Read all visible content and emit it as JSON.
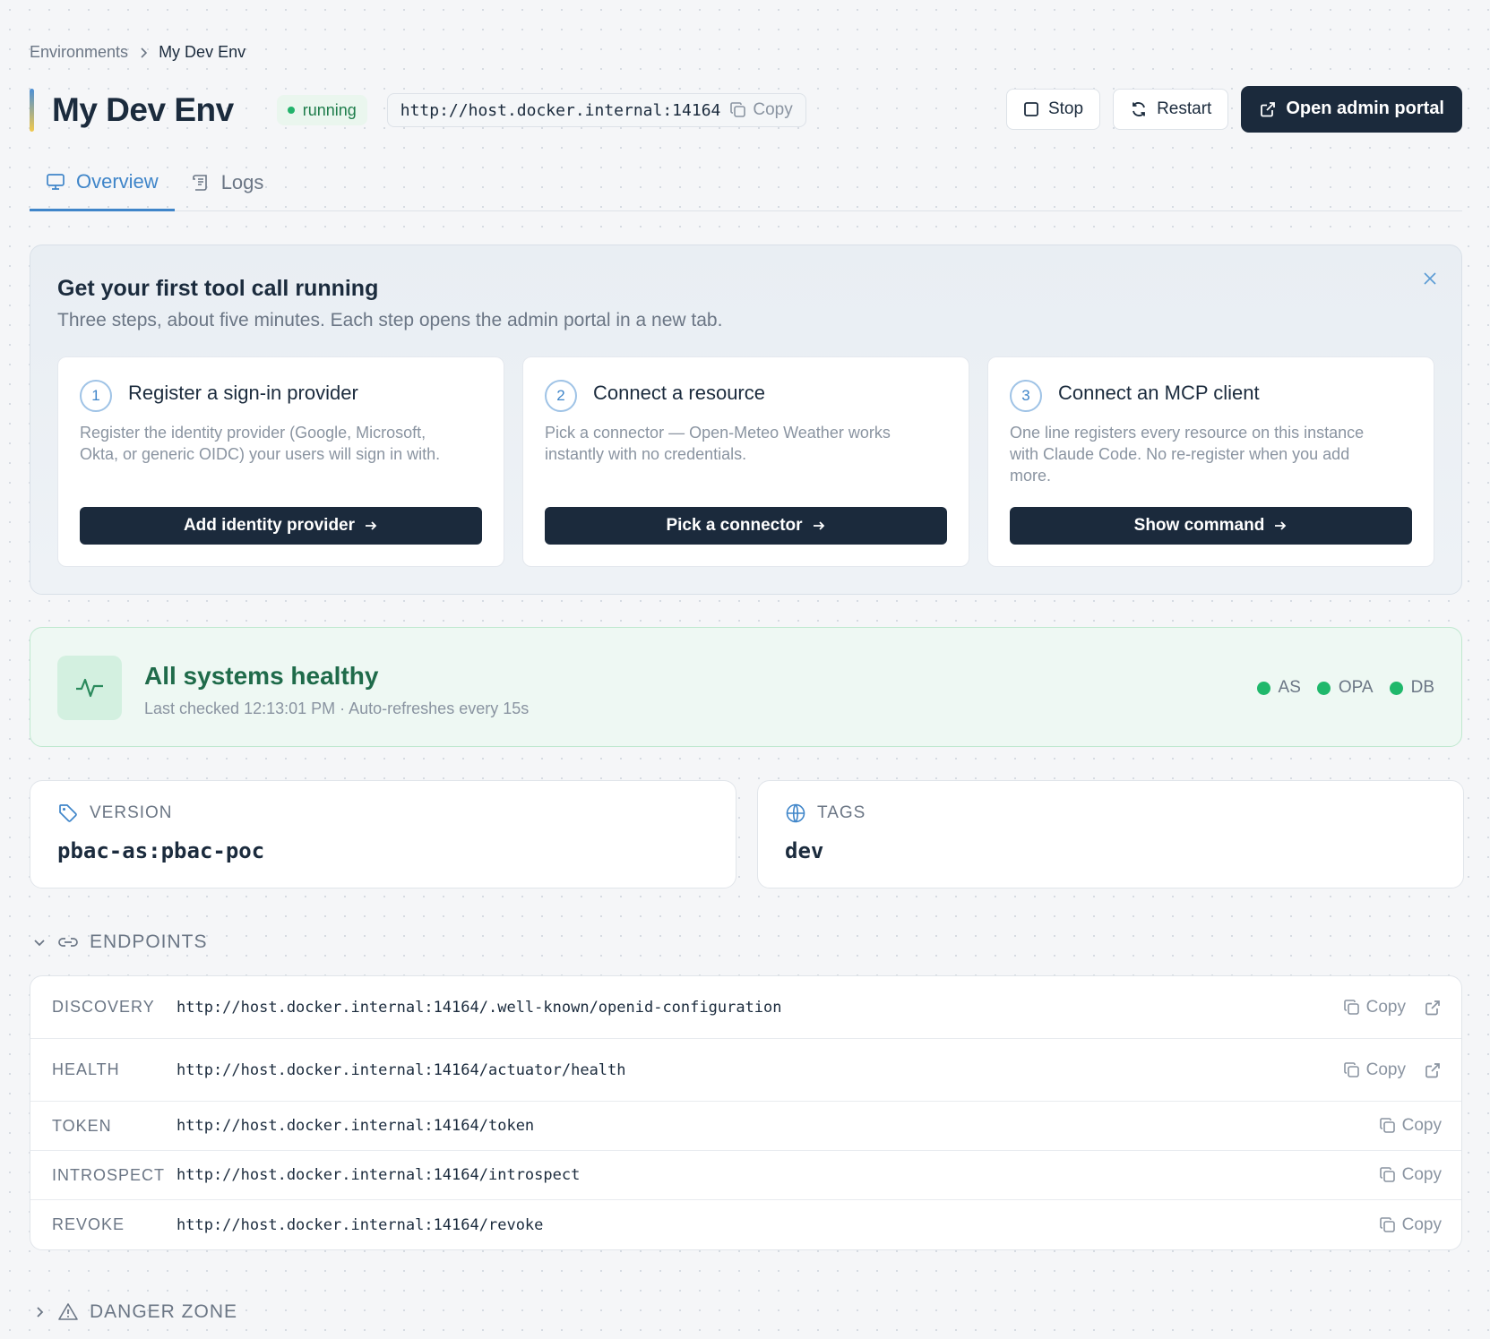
{
  "breadcrumb": {
    "parent": "Environments",
    "current": "My Dev Env"
  },
  "header": {
    "title": "My Dev Env",
    "status": "running",
    "url": "http://host.docker.internal:14164",
    "copy_label": "Copy",
    "stop_label": "Stop",
    "restart_label": "Restart",
    "open_portal_label": "Open admin portal"
  },
  "tabs": [
    {
      "label": "Overview",
      "icon": "monitor-icon",
      "active": true
    },
    {
      "label": "Logs",
      "icon": "scroll-icon",
      "active": false
    }
  ],
  "onboarding": {
    "title": "Get your first tool call running",
    "subtitle": "Three steps, about five minutes. Each step opens the admin portal in a new tab.",
    "steps": [
      {
        "number": "1",
        "title": "Register a sign-in provider",
        "description": "Register the identity provider (Google, Microsoft, Okta, or generic OIDC) your users will sign in with.",
        "button": "Add identity provider"
      },
      {
        "number": "2",
        "title": "Connect a resource",
        "description": "Pick a connector — Open-Meteo Weather works instantly with no credentials.",
        "button": "Pick a connector"
      },
      {
        "number": "3",
        "title": "Connect an MCP client",
        "description": "One line registers every resource on this instance with Claude Code. No re-register when you add more.",
        "button": "Show command"
      }
    ]
  },
  "health": {
    "title": "All systems healthy",
    "subtitle": "Last checked 12:13:01 PM · Auto-refreshes every 15s",
    "indicators": [
      "AS",
      "OPA",
      "DB"
    ],
    "color": "#1fb86b"
  },
  "version": {
    "label": "VERSION",
    "value": "pbac-as:pbac-poc"
  },
  "tags": {
    "label": "TAGS",
    "value": "dev"
  },
  "endpoints": {
    "title": "ENDPOINTS",
    "copy_label": "Copy",
    "rows": [
      {
        "label": "DISCOVERY",
        "url": "http://host.docker.internal:14164/.well-known/openid-configuration"
      },
      {
        "label": "HEALTH",
        "url": "http://host.docker.internal:14164/actuator/health"
      },
      {
        "label": "TOKEN",
        "url": "http://host.docker.internal:14164/token"
      },
      {
        "label": "INTROSPECT",
        "url": "http://host.docker.internal:14164/introspect"
      },
      {
        "label": "REVOKE",
        "url": "http://host.docker.internal:14164/revoke"
      }
    ]
  },
  "danger_zone": {
    "title": "DANGER ZONE"
  },
  "colors": {
    "accent": "#3f85c9",
    "primary_dark": "#1b2a3c",
    "success": "#1fb86b"
  }
}
